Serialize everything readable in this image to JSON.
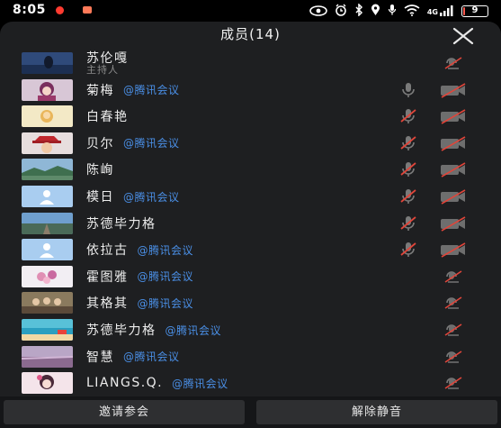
{
  "status_bar": {
    "time": "8:05",
    "battery": "9",
    "battery_level": 0.09,
    "signal_label": "4G",
    "accent_colors": {
      "dot1": "#ff3b30",
      "dot2": "#ff7a59"
    }
  },
  "header": {
    "title": "成员(14)",
    "close_icon": "close-icon"
  },
  "members": [
    {
      "name": "苏伦嘎",
      "role": "主持人",
      "tag": "",
      "mic": "none",
      "camera": "off",
      "avatar": "photo-silhouette"
    },
    {
      "name": "菊梅",
      "role": "",
      "tag": "@腾讯会议",
      "mic": "on",
      "camera": "off",
      "avatar": "anime-girl"
    },
    {
      "name": "白春艳",
      "role": "",
      "tag": "",
      "mic": "muted",
      "camera": "off",
      "avatar": "cartoon"
    },
    {
      "name": "贝尔",
      "role": "",
      "tag": "@腾讯会议",
      "mic": "muted",
      "camera": "off",
      "avatar": "red-hat"
    },
    {
      "name": "陈峋",
      "role": "",
      "tag": "",
      "mic": "muted",
      "camera": "off",
      "avatar": "landscape"
    },
    {
      "name": "模日",
      "role": "",
      "tag": "@腾讯会议",
      "mic": "muted",
      "camera": "off",
      "avatar": "default-person"
    },
    {
      "name": "苏德毕力格",
      "role": "",
      "tag": "",
      "mic": "muted",
      "camera": "off",
      "avatar": "sky-road"
    },
    {
      "name": "依拉古",
      "role": "",
      "tag": "@腾讯会议",
      "mic": "muted",
      "camera": "off",
      "avatar": "default-person"
    },
    {
      "name": "霍图雅",
      "role": "",
      "tag": "@腾讯会议",
      "mic": "none",
      "camera": "off",
      "avatar": "flowers"
    },
    {
      "name": "其格其",
      "role": "",
      "tag": "@腾讯会议",
      "mic": "none",
      "camera": "off",
      "avatar": "group-photo"
    },
    {
      "name": "苏德毕力格",
      "role": "",
      "tag": "@腾讯会议",
      "mic": "none",
      "camera": "off",
      "avatar": "beach"
    },
    {
      "name": "智慧",
      "role": "",
      "tag": "@腾讯会议",
      "mic": "none",
      "camera": "off",
      "avatar": "field"
    },
    {
      "name": "LIANGS.Q.",
      "role": "",
      "tag": "@腾讯会议",
      "mic": "none",
      "camera": "off",
      "avatar": "anime-pink"
    }
  ],
  "footer": {
    "invite_label": "邀请参会",
    "unmute_label": "解除静音"
  },
  "colors": {
    "tag_blue": "#4a8fe6",
    "sheet_bg": "#1e1f21",
    "mute_red": "#e0453a"
  }
}
